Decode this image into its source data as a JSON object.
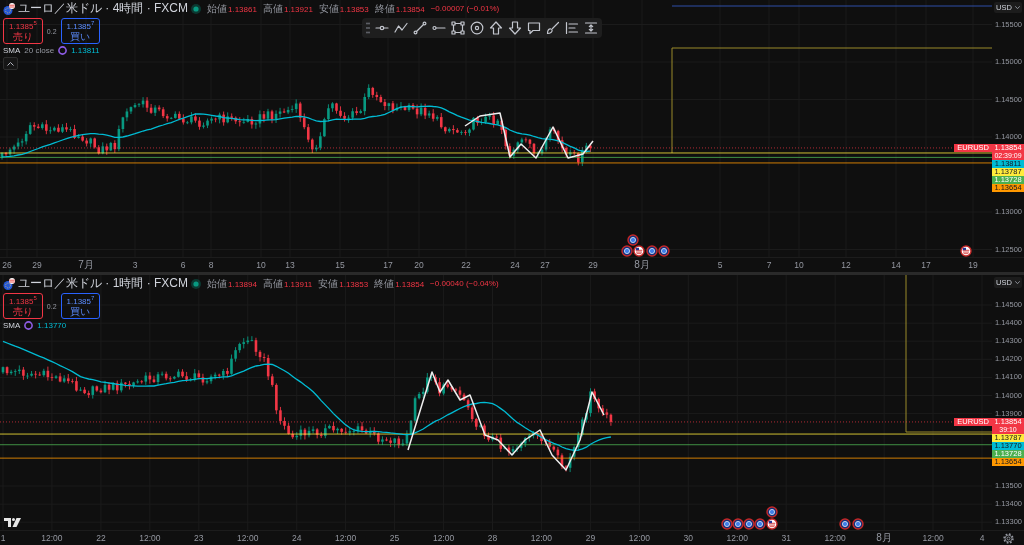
{
  "panes": [
    {
      "symbol": {
        "title": "ユーロ／米ドル · 4時間 · FXCM",
        "market_open": true
      },
      "ohlc": [
        {
          "label": "始値",
          "value": "1.13861"
        },
        {
          "label": "高値",
          "value": "1.13921"
        },
        {
          "label": "安値",
          "value": "1.13853"
        },
        {
          "label": "終値",
          "value": "1.13854"
        }
      ],
      "change": "−0.00007 (−0.01%)",
      "price_down": true,
      "drawing_toolbar": true,
      "trade": {
        "sell": {
          "price": "1.1385$^{5}$",
          "label": "売り"
        },
        "spread": "0.2",
        "buy": {
          "price": "1.1385$^{7}$",
          "label": "買い"
        }
      },
      "indicator": {
        "name": "SMA",
        "params": "20 close",
        "value": "1.13811"
      },
      "collapse_button": true,
      "currency": "USD",
      "price_labels": [
        "1.15500",
        "1.15000",
        "1.14500",
        "1.14000",
        "1.13000",
        "1.12500"
      ],
      "price_tags": [
        {
          "kind": "last",
          "symbol": "EURUSD",
          "price": "1.13854",
          "countdown": "02:39:09",
          "color": "#f23645"
        },
        {
          "kind": "sma",
          "price": "1.13811",
          "color": "#00bcd4"
        },
        {
          "kind": "level",
          "price": "1.13787",
          "color": "#ffeb3b"
        },
        {
          "kind": "level",
          "price": "1.13728",
          "color": "#4caf50"
        },
        {
          "kind": "level",
          "price": "1.13654",
          "color": "#ff9800"
        }
      ],
      "time_labels": [
        "26",
        "29",
        "7月",
        "3",
        "6",
        "8",
        "10",
        "13",
        "15",
        "17",
        "20",
        "22",
        "24",
        "27",
        "29",
        "8月",
        "5",
        "7",
        "10",
        "12",
        "14",
        "17",
        "19"
      ]
    },
    {
      "symbol": {
        "title": "ユーロ／米ドル · 1時間 · FXCM",
        "market_open": true
      },
      "ohlc": [
        {
          "label": "始値",
          "value": "1.13894"
        },
        {
          "label": "高値",
          "value": "1.13911"
        },
        {
          "label": "安値",
          "value": "1.13853"
        },
        {
          "label": "終値",
          "value": "1.13854"
        }
      ],
      "change": "−0.00040 (−0.04%)",
      "price_down": true,
      "trade": {
        "sell": {
          "price": "1.1385$^{5}$",
          "label": "売り"
        },
        "spread": "0.2",
        "buy": {
          "price": "1.1385$^{7}$",
          "label": "買い"
        }
      },
      "indicator": {
        "name": "SMA",
        "value": "1.13770"
      },
      "currency": "USD",
      "price_labels": [
        "1.14500",
        "1.14400",
        "1.14300",
        "1.14200",
        "1.14100",
        "1.14000",
        "1.13900",
        "1.13500",
        "1.13400",
        "1.13300"
      ],
      "price_tags": [
        {
          "kind": "last",
          "symbol": "EURUSD",
          "price": "1.13854",
          "countdown": "39:10",
          "color": "#f23645"
        },
        {
          "kind": "level",
          "price": "1.13787",
          "color": "#ffeb3b"
        },
        {
          "kind": "sma",
          "price": "1.13770",
          "color": "#00bcd4"
        },
        {
          "kind": "level",
          "price": "1.13728",
          "color": "#4caf50"
        },
        {
          "kind": "level",
          "price": "1.13654",
          "color": "#ff9800"
        }
      ],
      "time_labels": [
        "1",
        "12:00",
        "22",
        "12:00",
        "23",
        "12:00",
        "24",
        "12:00",
        "25",
        "12:00",
        "28",
        "12:00",
        "29",
        "12:00",
        "30",
        "12:00",
        "31",
        "12:00",
        "8月",
        "12:00",
        "4"
      ],
      "settings_button": true
    }
  ]
}
